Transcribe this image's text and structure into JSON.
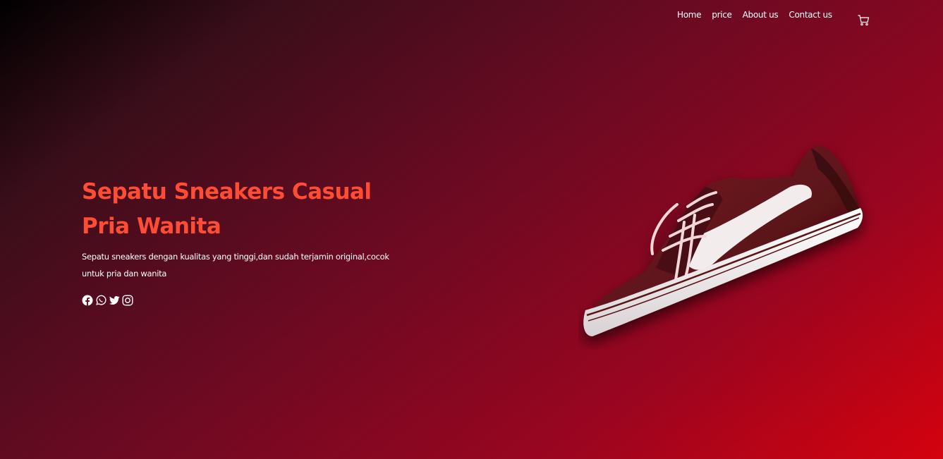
{
  "nav": {
    "items": [
      {
        "label": "Home"
      },
      {
        "label": "price"
      },
      {
        "label": "About us"
      },
      {
        "label": "Contact us"
      }
    ],
    "cart_icon": "cart-icon"
  },
  "hero": {
    "title": "Sepatu Sneakers Casual Pria Wanita",
    "description": "Sepatu sneakers dengan kualitas yang tinggi,dan sudah terjamin original,cocok untuk pria dan wanita"
  },
  "socials": [
    {
      "icon": "facebook-icon"
    },
    {
      "icon": "whatsapp-icon"
    },
    {
      "icon": "twitter-icon"
    },
    {
      "icon": "instagram-icon"
    }
  ],
  "colors": {
    "accent": "#ff4d35",
    "text": "#ffffff",
    "background_start": "#000000",
    "background_end": "#d4020e"
  }
}
